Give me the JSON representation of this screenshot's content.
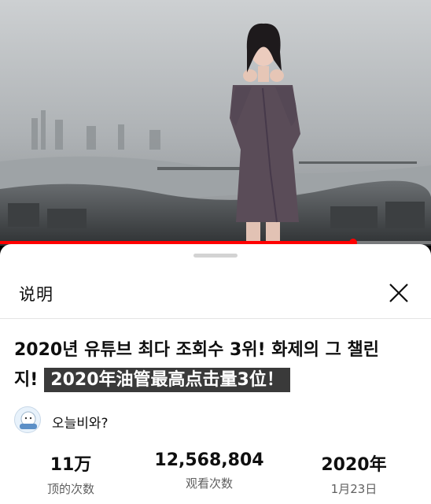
{
  "player": {
    "progress": 0.82
  },
  "description_panel": {
    "title": "说明",
    "close_icon": "close-icon",
    "video_title": "2020년 유튜브 최다 조회수 3위! 화제의 그 챌린지!",
    "video_title_translation": "2020年油管最高点击量3位！",
    "channel": {
      "avatar_icon": "channel-avatar",
      "name": "오늘비와?"
    },
    "stats": [
      {
        "value": "11万",
        "label": "顶的次数"
      },
      {
        "value": "12,568,804",
        "label": "观看次数"
      },
      {
        "value": "2020年",
        "label": "1月23日"
      }
    ]
  }
}
